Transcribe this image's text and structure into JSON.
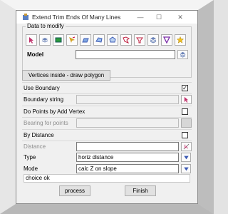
{
  "window": {
    "title": "Extend Trim Ends Of Many Lines",
    "minimize_glyph": "—",
    "maximize_glyph": "☐",
    "close_glyph": "✕"
  },
  "data_group": {
    "label": "Data to modify",
    "tools": [
      "pick-arrow-icon",
      "layers-icon",
      "model-icon",
      "cursor-icon",
      "box-icon",
      "polygon-icon",
      "poly-icon",
      "flag-icon",
      "funnel-icon",
      "stack-icon",
      "triangle-icon",
      "star-icon"
    ],
    "model_label": "Model",
    "model_value": ""
  },
  "vertices_button": "Vertices inside - draw polygon",
  "use_boundary": {
    "label": "Use Boundary",
    "checked_glyph": "✓"
  },
  "boundary_string": {
    "label": "Boundary string",
    "value": ""
  },
  "do_points": {
    "label": "Do Points by Add Vertex"
  },
  "bearing": {
    "label": "Bearing for points",
    "value": ""
  },
  "by_distance": {
    "label": "By Distance"
  },
  "distance": {
    "label": "Distance",
    "value": ""
  },
  "type": {
    "label": "Type",
    "value": "horiz distance"
  },
  "mode": {
    "label": "Mode",
    "value": "calc Z on slope"
  },
  "status": "choice ok",
  "process_button": "process",
  "finish_button": "Finish",
  "colors": {
    "accent": "#3c5ab4",
    "window_bg": "#f0f0f0"
  }
}
